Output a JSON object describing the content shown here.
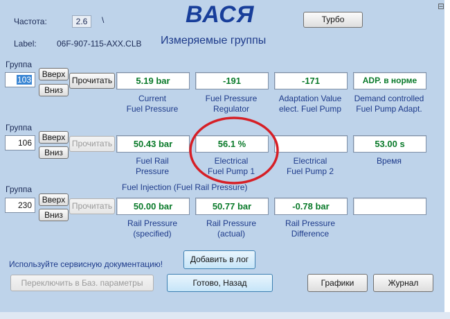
{
  "header": {
    "freq_label": "Частота:",
    "freq_value": "2.6",
    "freq_sep": "\\",
    "label_label": "Label:",
    "label_value": "06F-907-115-AXX.CLB",
    "title": "ВАСЯ",
    "subtitle": "Измеряемые группы",
    "turbo_button": "Турбо"
  },
  "groups": [
    {
      "label": "Группа",
      "number": "103",
      "up_button": "Вверх",
      "down_button": "Вниз",
      "read_button": "Прочитать",
      "heading": "",
      "fields": [
        {
          "value": "5.19 bar",
          "desc": "Current\nFuel Pressure"
        },
        {
          "value": "-191",
          "desc": "Fuel Pressure\nRegulator"
        },
        {
          "value": "-171",
          "desc": "Adaptation Value\nelect. Fuel Pump"
        },
        {
          "value": "ADP. в норме",
          "desc": "Demand controlled\nFuel Pump Adapt."
        }
      ]
    },
    {
      "label": "Группа",
      "number": "106",
      "up_button": "Вверх",
      "down_button": "Вниз",
      "read_button": "Прочитать",
      "heading": "",
      "fields": [
        {
          "value": "50.43 bar",
          "desc": "Fuel Rail\nPressure"
        },
        {
          "value": "56.1 %",
          "desc": "Electrical\nFuel Pump 1"
        },
        {
          "value": "",
          "desc": "Electrical\nFuel Pump 2"
        },
        {
          "value": "53.00 s",
          "desc": "Время"
        }
      ]
    },
    {
      "label": "Группа",
      "number": "230",
      "up_button": "Вверх",
      "down_button": "Вниз",
      "read_button": "Прочитать",
      "heading": "Fuel Injection (Fuel Rail Pressure)",
      "fields": [
        {
          "value": "50.00 bar",
          "desc": "Rail Pressure\n(specified)"
        },
        {
          "value": "50.77 bar",
          "desc": "Rail Pressure\n(actual)"
        },
        {
          "value": "-0.78 bar",
          "desc": "Rail Pressure\nDifference"
        },
        {
          "value": "",
          "desc": ""
        }
      ]
    }
  ],
  "footer": {
    "note": "Используйте сервисную документацию!",
    "add_log_button": "Добавить в лог",
    "switch_basic_button": "Переключить в Баз. параметры",
    "done_back_button": "Готово, Назад",
    "graphs_button": "Графики",
    "journal_button": "Журнал"
  },
  "colors": {
    "window_bg": "#bed3ea",
    "value_text": "#0a7a2a",
    "title_text": "#183e9a",
    "annotation_circle": "#d61f26"
  }
}
